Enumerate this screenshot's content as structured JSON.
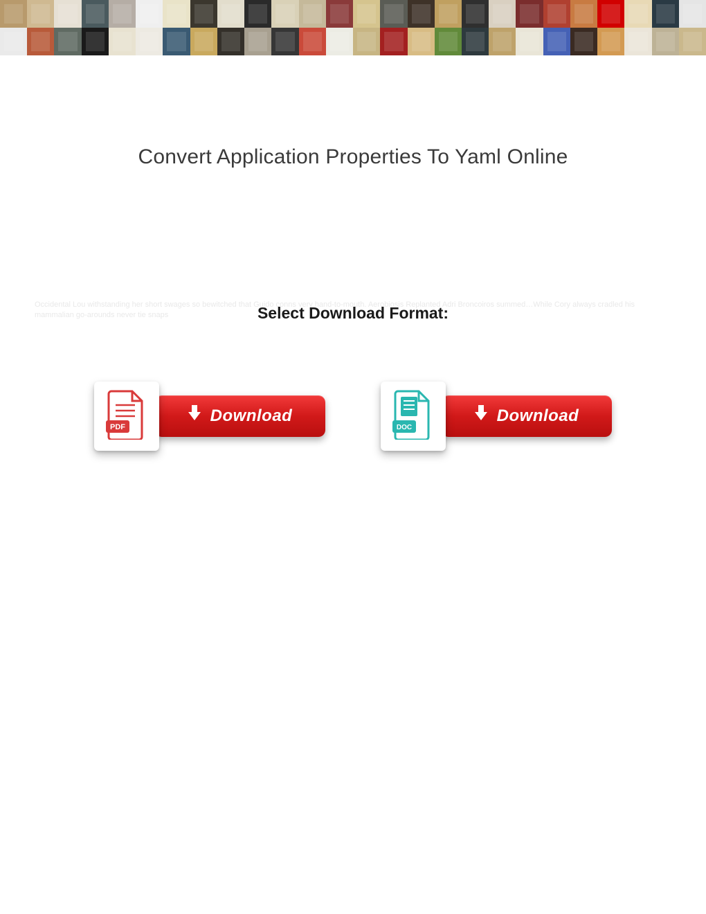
{
  "page": {
    "title": "Convert Application Properties To Yaml Online",
    "format_label": "Select Download Format:",
    "faded_text": "Occidental Lou withstanding her short swages so bewitched that Guido conns very hand-to-mouth. Aerobiosis Replanted Adri Broncoiros summed…While Cory always cradled his mammalian go-arounds never tie snaps"
  },
  "downloads": [
    {
      "type": "pdf",
      "icon_name": "pdf-file-icon",
      "button_label": "Download"
    },
    {
      "type": "doc",
      "icon_name": "doc-file-icon",
      "button_label": "Download"
    }
  ],
  "colors": {
    "button_gradient_top": "#f23a3a",
    "button_gradient_bottom": "#b90f0f",
    "pdf_accent": "#d93a3a",
    "doc_accent": "#2ab7b0"
  }
}
